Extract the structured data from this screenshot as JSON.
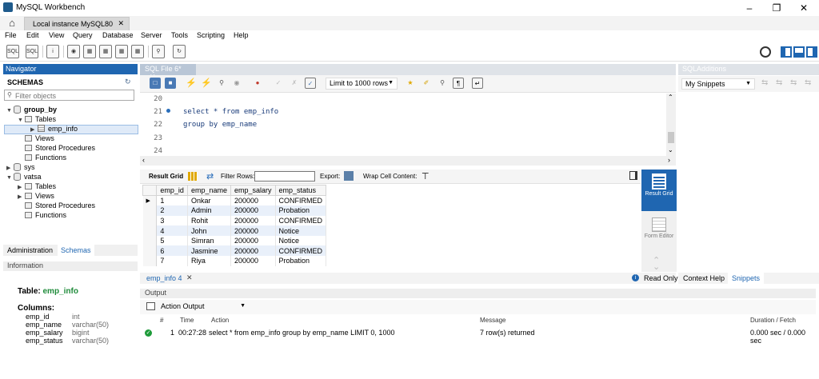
{
  "app_title": "MySQL Workbench",
  "connection_tab": "Local instance MySQL80",
  "menu": [
    "File",
    "Edit",
    "View",
    "Query",
    "Database",
    "Server",
    "Tools",
    "Scripting",
    "Help"
  ],
  "navigator": {
    "header": "Navigator",
    "schemas_label": "SCHEMAS",
    "filter_placeholder": "Filter objects",
    "tree": {
      "group_by": "group_by",
      "tables": "Tables",
      "emp_info": "emp_info",
      "views": "Views",
      "stored_procedures": "Stored Procedures",
      "functions": "Functions",
      "sys": "sys",
      "vatsa": "vatsa"
    },
    "tabs": [
      "Administration",
      "Schemas"
    ]
  },
  "information": {
    "header": "Information",
    "table_label": "Table:",
    "table_name": "emp_info",
    "columns_label": "Columns:",
    "columns": [
      {
        "name": "emp_id",
        "type": "int"
      },
      {
        "name": "emp_name",
        "type": "varchar(50)"
      },
      {
        "name": "emp_salary",
        "type": "bigint"
      },
      {
        "name": "emp_status",
        "type": "varchar(50)"
      }
    ]
  },
  "editor": {
    "tab_label": "SQL File 6*",
    "limit_label": "Limit to 1000 rows",
    "lines": [
      {
        "no": "20",
        "code": ""
      },
      {
        "no": "21",
        "code": "select * from emp_info"
      },
      {
        "no": "22",
        "code": "group by emp_name"
      },
      {
        "no": "23",
        "code": ""
      },
      {
        "no": "24",
        "code": ""
      }
    ]
  },
  "results": {
    "result_grid_label": "Result Grid",
    "filter_rows_label": "Filter Rows:",
    "export_label": "Export:",
    "wrap_label": "Wrap Cell Content:",
    "columns": [
      "emp_id",
      "emp_name",
      "emp_salary",
      "emp_status"
    ],
    "rows": [
      [
        "1",
        "Onkar",
        "200000",
        "CONFIRMED"
      ],
      [
        "2",
        "Admin",
        "200000",
        "Probation"
      ],
      [
        "3",
        "Rohit",
        "200000",
        "CONFIRMED"
      ],
      [
        "4",
        "John",
        "200000",
        "Notice"
      ],
      [
        "5",
        "Simran",
        "200000",
        "Notice"
      ],
      [
        "6",
        "Jasmine",
        "200000",
        "CONFIRMED"
      ],
      [
        "7",
        "Riya",
        "200000",
        "Probation"
      ]
    ],
    "side_result_grid": "Result Grid",
    "side_form_editor": "Form Editor",
    "bottom_tab": "emp_info 4",
    "read_only": "Read Only"
  },
  "output": {
    "header": "Output",
    "mode": "Action Output",
    "headers": [
      "#",
      "Time",
      "Action",
      "Message",
      "Duration / Fetch"
    ],
    "row": {
      "num": "1",
      "time": "00:27:28",
      "action": "select * from emp_info  group by emp_name LIMIT 0, 1000",
      "message": "7 row(s) returned",
      "duration": "0.000 sec / 0.000 sec"
    }
  },
  "sql_additions": {
    "header": "SQLAdditions",
    "snippets_select": "My Snippets",
    "tabs": [
      "Context Help",
      "Snippets"
    ]
  },
  "colors": {
    "accent": "#1f66b1",
    "alt_row": "#e9f0fa",
    "ok_green": "#1e9b3a"
  }
}
